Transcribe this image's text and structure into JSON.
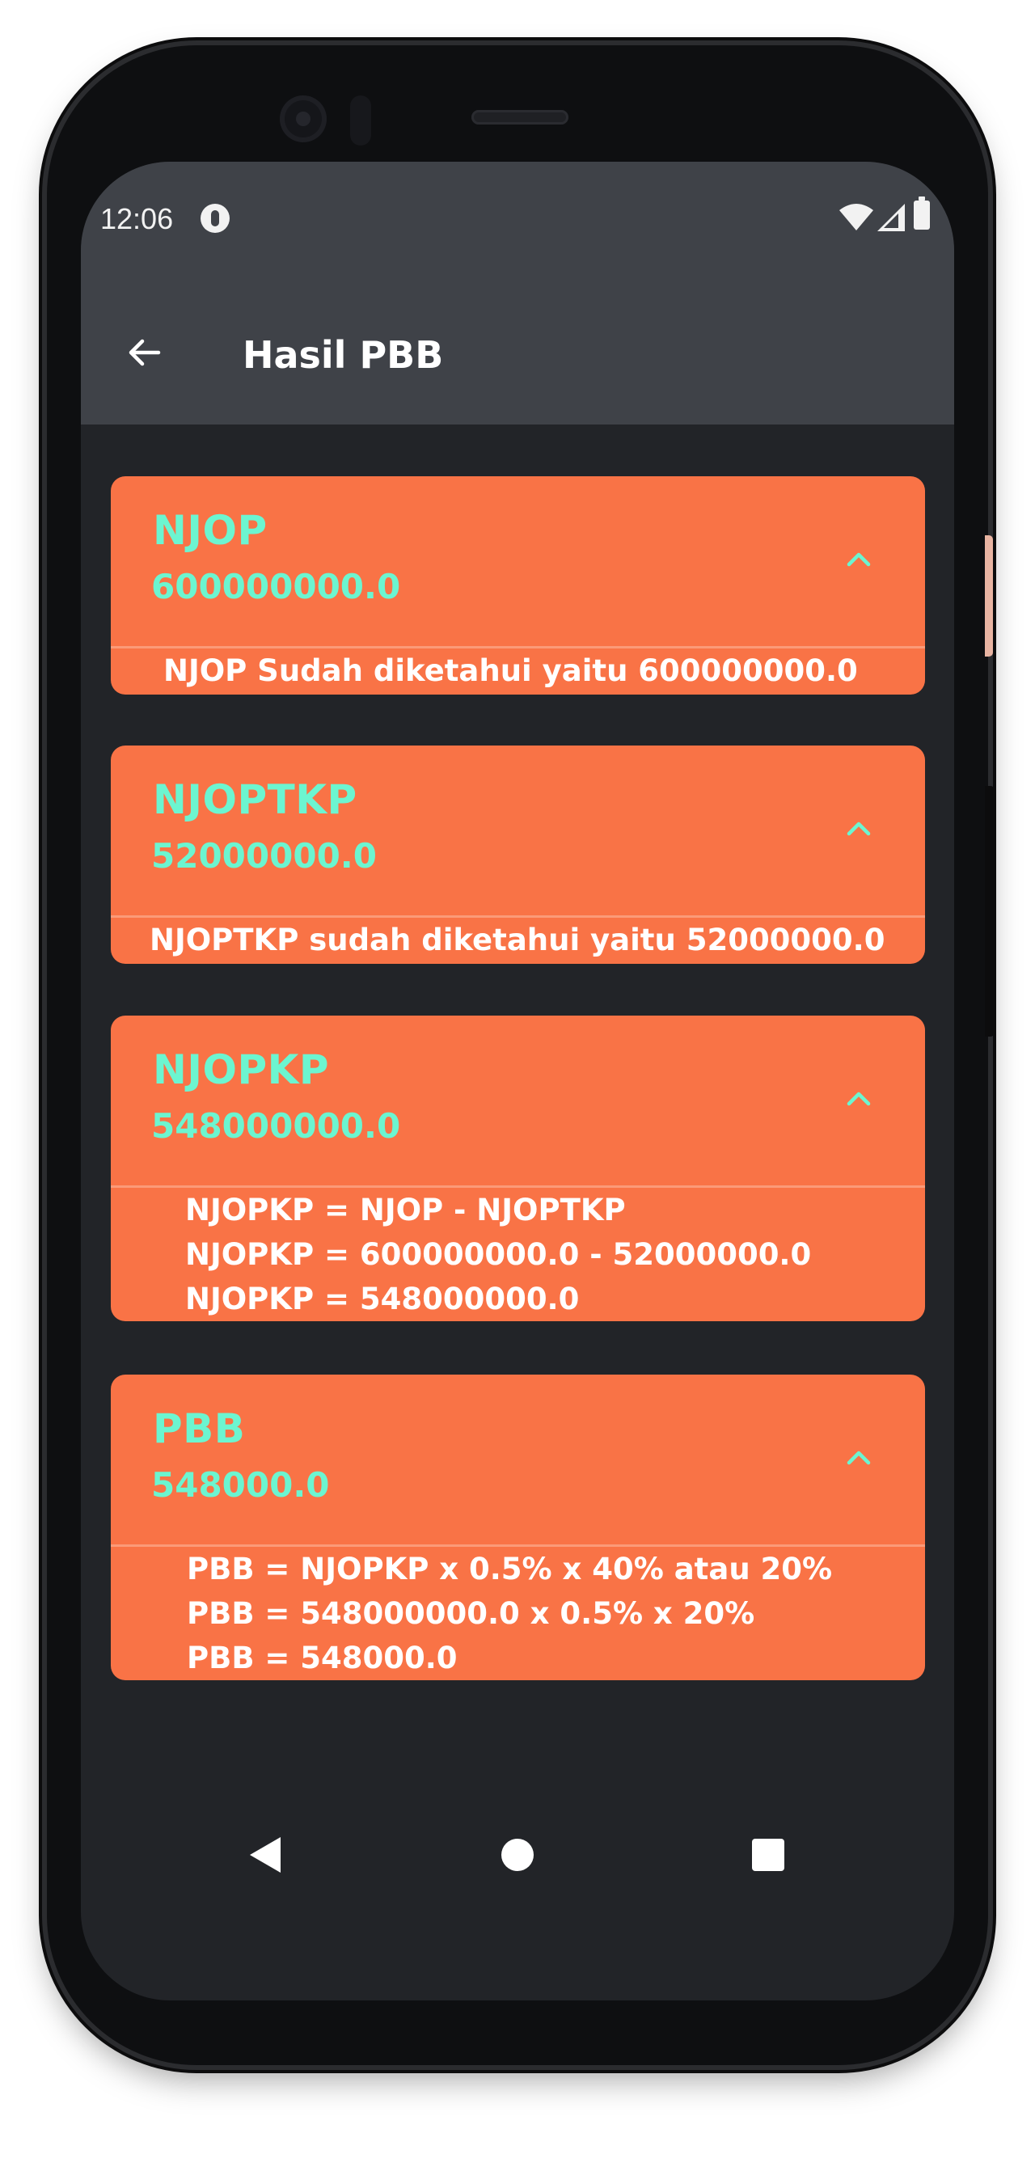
{
  "status_bar": {
    "time": "12:06"
  },
  "app_bar": {
    "title": "Hasil PBB"
  },
  "cards": [
    {
      "title": "NJOP",
      "value": "600000000.0",
      "details": [
        "NJOP Sudah diketahui yaitu 600000000.0"
      ]
    },
    {
      "title": "NJOPTKP",
      "value": "52000000.0",
      "details": [
        "NJOPTKP sudah diketahui yaitu 52000000.0"
      ]
    },
    {
      "title": "NJOPKP",
      "value": "548000000.0",
      "details": [
        "NJOPKP = NJOP - NJOPTKP",
        "NJOPKP = 600000000.0 - 52000000.0",
        "NJOPKP = 548000000.0"
      ]
    },
    {
      "title": "PBB",
      "value": "548000.0",
      "details": [
        "PBB = NJOPKP x 0.5% x 40% atau 20%",
        "PBB = 548000000.0 x 0.5% x 20%",
        "PBB = 548000.0"
      ]
    }
  ],
  "colors": {
    "card_background": "#f97346",
    "accent_text": "#6cf5d0",
    "app_bar": "#3f4248",
    "screen_background": "#222428"
  },
  "icons": {
    "back": "arrow-left-icon",
    "expand": "chevron-up-icon",
    "nav_back": "triangle-back-icon",
    "nav_home": "circle-home-icon",
    "nav_recents": "square-recents-icon"
  }
}
